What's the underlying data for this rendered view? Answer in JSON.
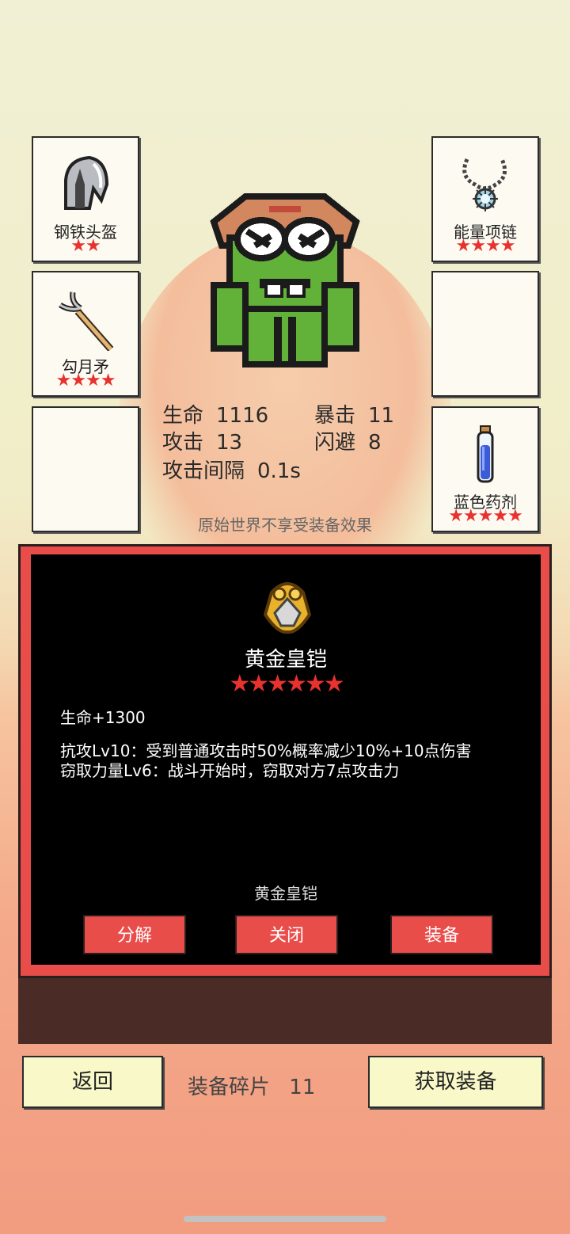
{
  "slots": {
    "helmet": {
      "name": "钢铁头盔",
      "stars": "★★",
      "icon": "helmet-icon"
    },
    "weapon": {
      "name": "勾月矛",
      "stars": "★★★★",
      "icon": "spear-icon"
    },
    "empty_left": {
      "name": "",
      "stars": ""
    },
    "necklace": {
      "name": "能量项链",
      "stars": "★★★★",
      "icon": "necklace-icon"
    },
    "empty_right": {
      "name": "",
      "stars": ""
    },
    "potion": {
      "name": "蓝色药剂",
      "stars": "★★★★★",
      "icon": "potion-icon"
    }
  },
  "stats": {
    "hp_label": "生命",
    "hp": "1116",
    "crit_label": "暴击",
    "crit": "11",
    "atk_label": "攻击",
    "atk": "13",
    "dodge_label": "闪避",
    "dodge": "8",
    "interval_label": "攻击间隔",
    "interval": "0.1s"
  },
  "note": "原始世界不享受装备效果",
  "dialog": {
    "item_name": "黄金皇铠",
    "stars": "★★★★★★",
    "bonus": "生命+1300",
    "effect1": "抗攻Lv10：受到普通攻击时50%概率减少10%+10点伤害",
    "effect2": "窃取力量Lv6：战斗开始时，窃取对方7点攻击力",
    "sub_name": "黄金皇铠",
    "buttons": {
      "decompose": "分解",
      "close": "关闭",
      "equip": "装备"
    }
  },
  "bottom": {
    "back": "返回",
    "fragments_label": "装备碎片",
    "fragments": "11",
    "get_equipment": "获取装备"
  },
  "colors": {
    "accent": "#e84d4a",
    "star": "#e8322e",
    "button_bg": "#f8f8c8"
  }
}
